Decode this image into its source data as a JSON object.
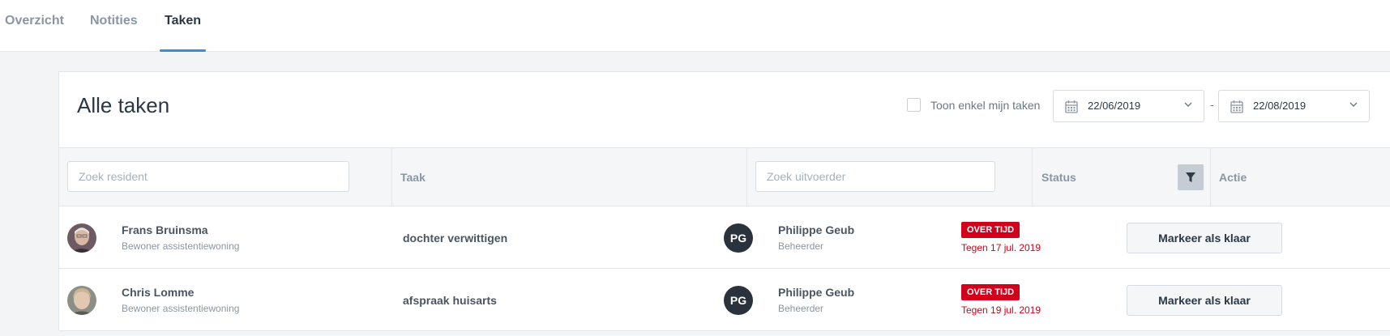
{
  "tabs": [
    {
      "label": "Overzicht",
      "active": false
    },
    {
      "label": "Notities",
      "active": false
    },
    {
      "label": "Taken",
      "active": true
    }
  ],
  "card": {
    "title": "Alle taken",
    "only_mine_label": "Toon enkel mijn taken",
    "only_mine_checked": false,
    "date_from": "22/06/2019",
    "date_separator": "-",
    "date_to": "22/08/2019"
  },
  "table": {
    "resident_search_placeholder": "Zoek resident",
    "task_header": "Taak",
    "executor_search_placeholder": "Zoek uitvoerder",
    "status_header": "Status",
    "action_header": "Actie",
    "rows": [
      {
        "resident_name": "Frans Bruinsma",
        "resident_type": "Bewoner assistentiewoning",
        "task": "dochter verwittigen",
        "executor_initials": "PG",
        "executor_name": "Philippe Geub",
        "executor_role": "Beheerder",
        "status_badge": "OVER TIJD",
        "due": "Tegen 17 jul. 2019",
        "action": "Markeer als klaar"
      },
      {
        "resident_name": "Chris Lomme",
        "resident_type": "Bewoner assistentiewoning",
        "task": "afspraak huisarts",
        "executor_initials": "PG",
        "executor_name": "Philippe Geub",
        "executor_role": "Beheerder",
        "status_badge": "OVER TIJD",
        "due": "Tegen 19 jul. 2019",
        "action": "Markeer als klaar"
      }
    ]
  },
  "colors": {
    "accent": "#2f8fe0",
    "overdue": "#d0021b",
    "initials_bg": "#2a323c"
  }
}
